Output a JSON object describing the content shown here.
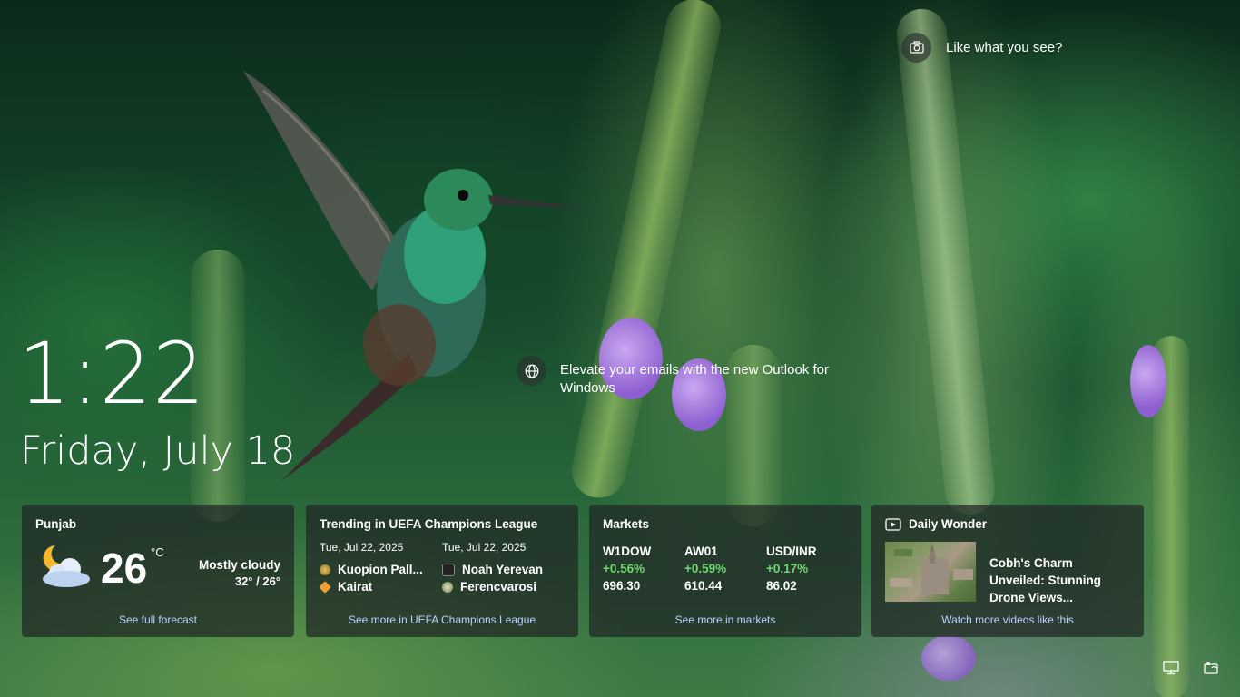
{
  "spotlight": {
    "icon": "camera-icon",
    "label": "Like what you see?"
  },
  "promo": {
    "icon": "globe-icon",
    "text": "Elevate your emails with the new Outlook for Windows"
  },
  "clock": {
    "time": "1:22",
    "date": "Friday, July 18"
  },
  "weather": {
    "location": "Punjab",
    "icon": "partly-cloudy-night-icon",
    "temp": "26",
    "unit": "°C",
    "condition": "Mostly cloudy",
    "range": "32° / 26°",
    "link": "See full forecast"
  },
  "trending": {
    "title": "Trending in UEFA Champions League",
    "matches": [
      {
        "date": "Tue, Jul 22, 2025",
        "team1": "Kuopion Pall...",
        "team2": "Kairat"
      },
      {
        "date": "Tue, Jul 22, 2025",
        "team1": "Noah Yerevan",
        "team2": "Ferencvarosi"
      }
    ],
    "link": "See more in UEFA Champions League"
  },
  "markets": {
    "title": "Markets",
    "tickers": [
      {
        "symbol": "W1DOW",
        "change": "+0.56%",
        "price": "696.30"
      },
      {
        "symbol": "AW01",
        "change": "+0.59%",
        "price": "610.44"
      },
      {
        "symbol": "USD/INR",
        "change": "+0.17%",
        "price": "86.02"
      }
    ],
    "change_color": "#6fd86f",
    "link": "See more in markets"
  },
  "daily_wonder": {
    "icon": "video-icon",
    "title": "Daily Wonder",
    "video_title": "Cobh's Charm Unveiled: Stunning Drone Views...",
    "link": "Watch more videos like this"
  },
  "tray": {
    "network_icon": "network-icon",
    "accessibility_icon": "accessibility-icon"
  }
}
